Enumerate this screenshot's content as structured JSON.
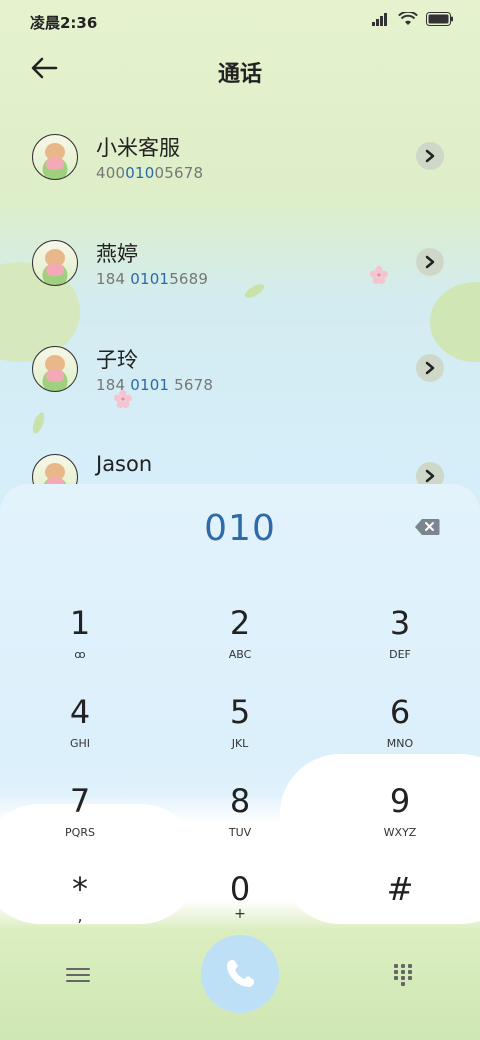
{
  "status_bar": {
    "time": "凌晨2:36",
    "icons": [
      "signal-icon",
      "wifi-icon",
      "battery-icon"
    ]
  },
  "header": {
    "title": "通话",
    "back_icon": "back-arrow-icon"
  },
  "contacts": [
    {
      "name": "小米客服",
      "number_pre": "400",
      "number_hl": "010",
      "number_post": "05678"
    },
    {
      "name": "燕婷",
      "number_pre": "184 ",
      "number_hl": "0101",
      "number_post": "5689"
    },
    {
      "name": "子玲",
      "number_pre": "184 ",
      "number_hl": "0101",
      "number_post": " 5678"
    },
    {
      "name": "Jason",
      "number_pre": "",
      "number_hl": "",
      "number_post": ""
    }
  ],
  "dialer": {
    "input": "010",
    "keys": [
      {
        "digit": "1",
        "letters": "ꝏ"
      },
      {
        "digit": "2",
        "letters": "ABC"
      },
      {
        "digit": "3",
        "letters": "DEF"
      },
      {
        "digit": "4",
        "letters": "GHI"
      },
      {
        "digit": "5",
        "letters": "JKL"
      },
      {
        "digit": "6",
        "letters": "MNO"
      },
      {
        "digit": "7",
        "letters": "PQRS"
      },
      {
        "digit": "8",
        "letters": "TUV"
      },
      {
        "digit": "9",
        "letters": "WXYZ"
      },
      {
        "digit": "*",
        "letters": ","
      },
      {
        "digit": "0",
        "letters": "+"
      },
      {
        "digit": "#",
        "letters": ""
      }
    ],
    "bottom": {
      "menu_icon": "menu-icon",
      "call_icon": "phone-icon",
      "keypad_icon": "keypad-icon"
    }
  },
  "colors": {
    "accent": "#2e6ba8",
    "call_button": "#bde0f6"
  }
}
